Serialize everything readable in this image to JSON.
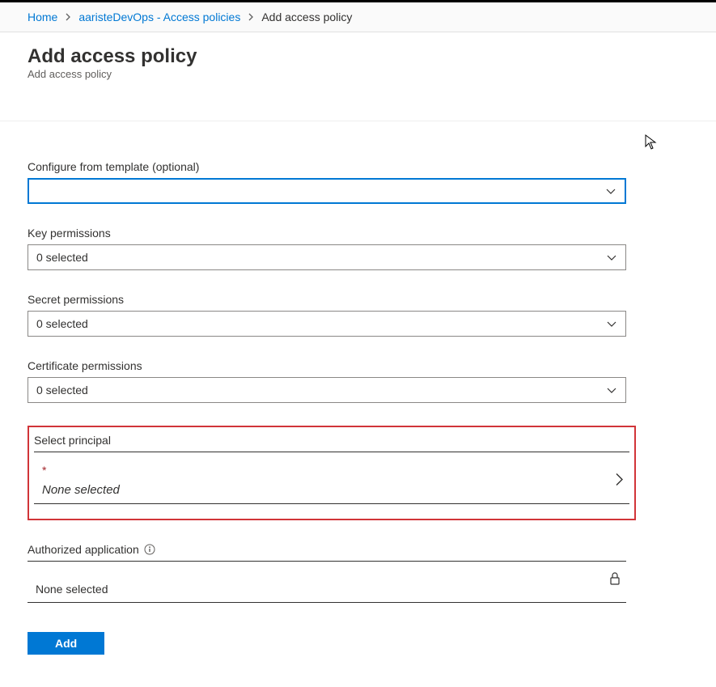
{
  "breadcrumb": {
    "home": "Home",
    "vault": "aaristeDevOps - Access policies",
    "current": "Add access policy"
  },
  "header": {
    "title": "Add access policy",
    "subtitle": "Add access policy"
  },
  "fields": {
    "template": {
      "label": "Configure from template (optional)",
      "value": ""
    },
    "key_permissions": {
      "label": "Key permissions",
      "value": "0 selected"
    },
    "secret_permissions": {
      "label": "Secret permissions",
      "value": "0 selected"
    },
    "certificate_permissions": {
      "label": "Certificate permissions",
      "value": "0 selected"
    },
    "select_principal": {
      "label": "Select principal",
      "required_marker": "*",
      "value": "None selected"
    },
    "authorized_application": {
      "label": "Authorized application",
      "value": "None selected"
    }
  },
  "buttons": {
    "add": "Add"
  }
}
